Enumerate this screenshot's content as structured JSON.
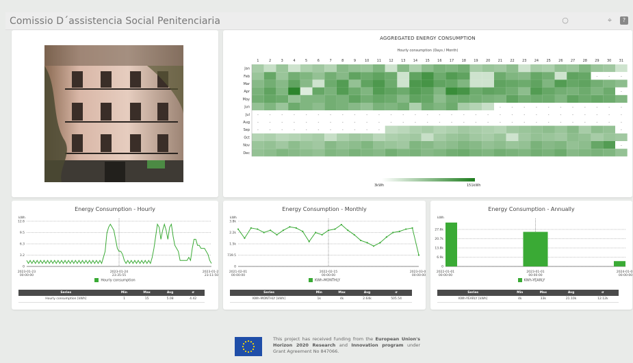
{
  "window": {
    "title": "Comissio D´assistencia Social Penitenciaria"
  },
  "heatmap": {
    "title": "AGGREGATED ENERGY CONSUMPTION",
    "subtitle": "Hourly consumption (Days / Month)",
    "days": [
      "1",
      "2",
      "3",
      "4",
      "5",
      "6",
      "7",
      "8",
      "9",
      "10",
      "11",
      "12",
      "13",
      "14",
      "15",
      "16",
      "17",
      "18",
      "19",
      "20",
      "21",
      "22",
      "23",
      "24",
      "25",
      "26",
      "27",
      "28",
      "29",
      "30",
      "31"
    ],
    "months": [
      "Jan",
      "Feb",
      "Mar",
      "Apr",
      "May",
      "Jun",
      "Jul",
      "Aug",
      "Sep",
      "Oct",
      "Nov",
      "Dec"
    ],
    "scale_min": "3kWh",
    "scale_max": "151kWh",
    "missing": "-"
  },
  "hourly": {
    "title": "Energy Consumption - Hourly",
    "unit": "kWh",
    "y_ticks": [
      "12.6",
      "9.5",
      "6.3",
      "3.2",
      "0"
    ],
    "x_labels": [
      [
        "2023-01-23",
        "00:00:00"
      ],
      [
        "2023-01-24",
        "23:35:55"
      ],
      [
        "2023-01-26",
        "23:11:50"
      ]
    ],
    "legend": "Hourly consumption",
    "table": {
      "headers": [
        "Series",
        "Min",
        "Max",
        "Avg",
        "σ"
      ],
      "row": [
        "Hourly consumption [kWh]",
        "1",
        "15",
        "5.08",
        "4.42"
      ]
    }
  },
  "monthly": {
    "title": "Energy Consumption - Monthly",
    "unit": "kWh",
    "y_ticks": [
      "3.8k",
      "2.2k",
      "1.5k",
      "739.5",
      "0"
    ],
    "x_labels": [
      [
        "2021-02-01",
        "00:00:00"
      ],
      [
        "2022-02-15",
        "00:00:00"
      ],
      [
        "2023-03-01",
        "00:00:00"
      ]
    ],
    "legend": "KWh-MONTHLY",
    "table": {
      "headers": [
        "Series",
        "Min",
        "Max",
        "Avg",
        "σ"
      ],
      "row": [
        "KWh-MONTHLY [kWh]",
        "1k",
        "4k",
        "2.64k",
        "505.54"
      ]
    }
  },
  "annual": {
    "title": "Energy Consumption - Annually",
    "unit": "kWh",
    "y_ticks": [
      "27.6k",
      "20.7k",
      "13.8k",
      "6.9k",
      "0"
    ],
    "x_labels": [
      [
        "2022-01-01",
        "00:00:00"
      ],
      [
        "2023-01-01",
        "00:00:00"
      ],
      [
        "2024-01-01",
        "00:00:00"
      ]
    ],
    "legend": "KWh-YEARLY",
    "table": {
      "headers": [
        "Series",
        "Min",
        "Max",
        "Avg",
        "σ"
      ],
      "row": [
        "KWh-YEARLY [kWh]",
        "4k",
        "33k",
        "21.10k",
        "12.12k"
      ]
    }
  },
  "footer": {
    "t1": "This project has received funding from the ",
    "b1": "European Union's Horizon 2020 Research",
    "t2": " and ",
    "b2": "Innovation program",
    "t3": " under Grant Agreement No 847066."
  },
  "colors": {
    "accent": "#3aaa35",
    "heat_low": "#e8f3e4",
    "heat_high": "#1e7d1e",
    "table_header": "#4a4a4a"
  },
  "chart_data": [
    {
      "type": "heatmap",
      "title": "AGGREGATED ENERGY CONSUMPTION",
      "subtitle": "Hourly consumption (Days / Month)",
      "x": [
        "1",
        "2",
        "3",
        "4",
        "5",
        "6",
        "7",
        "8",
        "9",
        "10",
        "11",
        "12",
        "13",
        "14",
        "15",
        "16",
        "17",
        "18",
        "19",
        "20",
        "21",
        "22",
        "23",
        "24",
        "25",
        "26",
        "27",
        "28",
        "29",
        "30",
        "31"
      ],
      "y": [
        "Jan",
        "Feb",
        "Mar",
        "Apr",
        "May",
        "Jun",
        "Jul",
        "Aug",
        "Sep",
        "Oct",
        "Nov",
        "Dec"
      ],
      "scale": [
        3,
        151
      ],
      "values": [
        [
          45,
          20,
          55,
          15,
          40,
          50,
          35,
          70,
          60,
          55,
          75,
          15,
          70,
          40,
          65,
          80,
          75,
          85,
          45,
          55,
          50,
          65,
          15,
          45,
          40,
          60,
          55,
          75,
          55,
          50,
          15
        ],
        [
          55,
          95,
          55,
          85,
          75,
          60,
          85,
          70,
          100,
          90,
          100,
          90,
          15,
          100,
          120,
          90,
          110,
          100,
          15,
          15,
          90,
          75,
          70,
          95,
          85,
          15,
          100,
          95,
          null,
          null,
          null
        ],
        [
          70,
          85,
          70,
          100,
          70,
          15,
          90,
          110,
          60,
          100,
          115,
          90,
          15,
          115,
          120,
          100,
          95,
          75,
          15,
          15,
          100,
          95,
          90,
          100,
          75,
          110,
          95,
          100,
          85,
          75,
          65
        ],
        [
          80,
          100,
          75,
          140,
          3,
          95,
          80,
          110,
          90,
          75,
          110,
          100,
          90,
          110,
          100,
          75,
          130,
          120,
          90,
          100,
          95,
          85,
          65,
          110,
          95,
          85,
          80,
          90,
          75,
          90,
          null
        ],
        [
          85,
          95,
          90,
          60,
          75,
          75,
          85,
          80,
          100,
          85,
          95,
          90,
          70,
          100,
          95,
          65,
          85,
          90,
          85,
          80,
          75,
          100,
          85,
          90,
          90,
          75,
          100,
          90,
          95,
          90,
          75
        ],
        [
          60,
          75,
          55,
          90,
          75,
          65,
          85,
          80,
          70,
          60,
          80,
          75,
          85,
          40,
          85,
          75,
          90,
          45,
          35,
          20,
          null,
          null,
          null,
          null,
          null,
          null,
          null,
          null,
          null,
          null,
          null
        ],
        [
          null,
          null,
          null,
          null,
          null,
          null,
          null,
          null,
          null,
          null,
          null,
          null,
          null,
          null,
          null,
          null,
          null,
          null,
          null,
          null,
          null,
          null,
          null,
          null,
          null,
          null,
          null,
          null,
          null,
          null,
          null
        ],
        [
          null,
          null,
          null,
          null,
          null,
          null,
          null,
          null,
          null,
          null,
          null,
          null,
          null,
          null,
          null,
          null,
          null,
          null,
          null,
          null,
          null,
          null,
          null,
          null,
          null,
          null,
          null,
          null,
          null,
          null,
          null
        ],
        [
          null,
          null,
          null,
          null,
          null,
          null,
          null,
          null,
          null,
          null,
          null,
          25,
          30,
          40,
          45,
          35,
          40,
          50,
          45,
          40,
          35,
          50,
          55,
          60,
          65,
          55,
          70,
          45,
          65,
          60,
          null
        ],
        [
          35,
          40,
          30,
          35,
          40,
          45,
          20,
          40,
          50,
          45,
          30,
          40,
          45,
          50,
          20,
          45,
          55,
          60,
          50,
          45,
          55,
          15,
          50,
          60,
          55,
          50,
          65,
          60,
          45,
          55,
          50
        ],
        [
          55,
          60,
          50,
          65,
          55,
          50,
          70,
          60,
          65,
          75,
          60,
          55,
          50,
          75,
          70,
          60,
          65,
          75,
          70,
          60,
          65,
          55,
          60,
          80,
          70,
          75,
          60,
          65,
          95,
          110,
          null
        ],
        [
          60,
          65,
          75,
          70,
          65,
          60,
          75,
          70,
          80,
          75,
          70,
          85,
          75,
          80,
          70,
          75,
          85,
          90,
          80,
          75,
          85,
          80,
          75,
          85,
          80,
          90,
          70,
          75,
          80,
          75,
          60
        ]
      ]
    },
    {
      "type": "line",
      "title": "Energy Consumption - Hourly",
      "ylabel": "kWh",
      "ylim": [
        0,
        15
      ],
      "series": [
        {
          "name": "Hourly consumption",
          "values": [
            2,
            1,
            2,
            1,
            2,
            1,
            2,
            1,
            2,
            1,
            2,
            1,
            2,
            1,
            2,
            1,
            2,
            1,
            2,
            1,
            2,
            1,
            2,
            1,
            2,
            1,
            2,
            1,
            2,
            1,
            2,
            1,
            2,
            1,
            2,
            1,
            2,
            1,
            2,
            1,
            2,
            1,
            2,
            1,
            3,
            5,
            11,
            13,
            14,
            13,
            12,
            9,
            6,
            5,
            5,
            4,
            2,
            1,
            2,
            1,
            2,
            1,
            2,
            1,
            2,
            1,
            2,
            1,
            2,
            1,
            2,
            1,
            3,
            6,
            10,
            14,
            13,
            9,
            12,
            14,
            12,
            9,
            13,
            14,
            10,
            7,
            6,
            5,
            2,
            2,
            2,
            2,
            2,
            3,
            2,
            6,
            9,
            9,
            7,
            7,
            6,
            6,
            6,
            5,
            4,
            2,
            1
          ]
        }
      ]
    },
    {
      "type": "line",
      "title": "Energy Consumption - Monthly",
      "ylabel": "kWh",
      "ylim": [
        0,
        4000
      ],
      "series": [
        {
          "name": "KWh-MONTHLY",
          "values": [
            3300,
            2500,
            3400,
            3300,
            3000,
            3200,
            2800,
            3200,
            3500,
            3400,
            3100,
            2200,
            3000,
            2800,
            3200,
            3300,
            3700,
            3200,
            2800,
            2300,
            2100,
            1800,
            2100,
            2600,
            3000,
            3100,
            3300,
            3400,
            1000
          ]
        }
      ]
    },
    {
      "type": "bar",
      "title": "Energy Consumption - Annually",
      "ylabel": "kWh",
      "ylim": [
        0,
        34000
      ],
      "categories": [
        "2022",
        "2023",
        "2024"
      ],
      "series": [
        {
          "name": "KWh-YEARLY",
          "values": [
            33000,
            26000,
            4000
          ]
        }
      ]
    }
  ]
}
